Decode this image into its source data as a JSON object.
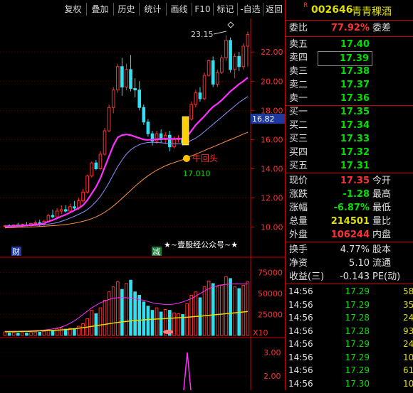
{
  "toolbar": {
    "buttons": [
      "复权",
      "叠加",
      "历史",
      "统计",
      "画线",
      "F10",
      "标记",
      "-自选",
      "返回"
    ]
  },
  "stock": {
    "badge": "R",
    "code": "002646",
    "name": "青青稞酒"
  },
  "order_book": {
    "weibi_label": "委比",
    "weibi_value": "77.92%",
    "weicha_label": "委差",
    "sells": [
      {
        "label": "卖五",
        "price": "17.40"
      },
      {
        "label": "卖四",
        "price": "17.39"
      },
      {
        "label": "卖三",
        "price": "17.38"
      },
      {
        "label": "卖二",
        "price": "17.37"
      },
      {
        "label": "卖一",
        "price": "17.36"
      }
    ],
    "buys": [
      {
        "label": "买一",
        "price": "17.35"
      },
      {
        "label": "买二",
        "price": "17.34"
      },
      {
        "label": "买三",
        "price": "17.33"
      },
      {
        "label": "买四",
        "price": "17.32"
      },
      {
        "label": "买五",
        "price": "17.31"
      }
    ]
  },
  "quote": [
    {
      "label": "现价",
      "value": "17.35",
      "label2": "今开",
      "color": "#ff3030"
    },
    {
      "label": "涨跌",
      "value": "-1.28",
      "label2": "最高",
      "color": "#00e000"
    },
    {
      "label": "涨幅",
      "value": "-6.87%",
      "label2": "最低",
      "color": "#00e000"
    },
    {
      "label": "总量",
      "value": "214501",
      "label2": "量比",
      "color": "#e0e000"
    },
    {
      "label": "外盘",
      "value": "106244",
      "label2": "内盘",
      "color": "#ff3030"
    }
  ],
  "quote2": [
    {
      "label": "换手",
      "value": "4.77%",
      "label2": "股本",
      "color": "#e0e0e0"
    },
    {
      "label": "净资",
      "value": "5.10",
      "label2": "流通",
      "color": "#e0e0e0"
    },
    {
      "label": "收益(三)",
      "value": "-0.143",
      "label2": "PE(动)",
      "color": "#e0e0e0"
    }
  ],
  "ticks": [
    {
      "time": "14:56",
      "price": "17.29",
      "vol": "58"
    },
    {
      "time": "14:56",
      "price": "17.29",
      "vol": "35"
    },
    {
      "time": "14:56",
      "price": "17.28",
      "vol": "24"
    },
    {
      "time": "14:56",
      "price": "17.28",
      "vol": "93"
    },
    {
      "time": "14:56",
      "price": "17.29",
      "vol": "24"
    },
    {
      "time": "14:56",
      "price": "17.29",
      "vol": "10"
    },
    {
      "time": "14:56",
      "price": "17.29",
      "vol": "61"
    },
    {
      "time": "14:56",
      "price": "17.30",
      "vol": "109"
    }
  ],
  "chart": {
    "annotation_high": "23.15",
    "current_price_tag": "16.82",
    "signal_label": "牛回头",
    "signal_price": "17.010",
    "watermark": "★~壹股经公众号~★",
    "marker_cai": "财",
    "marker_jian": "减",
    "vol_multiplier": "X10",
    "price_axis": [
      "22.00",
      "20.00",
      "18.00",
      "16.00",
      "14.00",
      "12.00",
      "10.00"
    ],
    "vol_axis": [
      "75000",
      "50000",
      "25000"
    ],
    "ind_axis": [
      "3.00",
      "2.00"
    ],
    "colors": {
      "up": "#ff3030",
      "down": "#30e0f0",
      "ma5": "#ff30ff",
      "ma10": "#9090ff",
      "ma20": "#ff9040",
      "volma": "#e0e000"
    }
  },
  "chart_data": {
    "type": "candlestick",
    "candles": [
      {
        "o": 10.05,
        "h": 10.15,
        "l": 9.95,
        "c": 10.1
      },
      {
        "o": 10.1,
        "h": 10.2,
        "l": 10.0,
        "c": 10.08
      },
      {
        "o": 10.05,
        "h": 10.2,
        "l": 10.0,
        "c": 10.15
      },
      {
        "o": 10.15,
        "h": 10.3,
        "l": 10.05,
        "c": 10.1
      },
      {
        "o": 10.1,
        "h": 10.25,
        "l": 10.0,
        "c": 10.2
      },
      {
        "o": 10.15,
        "h": 10.35,
        "l": 10.05,
        "c": 10.1
      },
      {
        "o": 10.1,
        "h": 10.3,
        "l": 10.0,
        "c": 10.25
      },
      {
        "o": 10.25,
        "h": 10.45,
        "l": 10.15,
        "c": 10.3
      },
      {
        "o": 10.3,
        "h": 10.5,
        "l": 10.05,
        "c": 10.15
      },
      {
        "o": 10.2,
        "h": 10.5,
        "l": 10.1,
        "c": 10.4
      },
      {
        "o": 10.4,
        "h": 10.9,
        "l": 10.3,
        "c": 10.8
      },
      {
        "o": 10.8,
        "h": 11.2,
        "l": 10.6,
        "c": 10.7
      },
      {
        "o": 10.7,
        "h": 11.3,
        "l": 10.6,
        "c": 11.1
      },
      {
        "o": 11.1,
        "h": 11.5,
        "l": 10.9,
        "c": 11.2
      },
      {
        "o": 11.2,
        "h": 11.5,
        "l": 11.0,
        "c": 11.1
      },
      {
        "o": 11.1,
        "h": 11.6,
        "l": 11.0,
        "c": 11.4
      },
      {
        "o": 11.4,
        "h": 11.8,
        "l": 11.2,
        "c": 11.3
      },
      {
        "o": 11.3,
        "h": 12.0,
        "l": 11.2,
        "c": 11.8
      },
      {
        "o": 11.8,
        "h": 12.6,
        "l": 11.7,
        "c": 12.4
      },
      {
        "o": 12.4,
        "h": 13.6,
        "l": 12.3,
        "c": 13.5
      },
      {
        "o": 13.5,
        "h": 14.5,
        "l": 13.4,
        "c": 14.4
      },
      {
        "o": 14.4,
        "h": 14.6,
        "l": 13.9,
        "c": 14.0
      },
      {
        "o": 14.0,
        "h": 15.2,
        "l": 13.9,
        "c": 15.0
      },
      {
        "o": 15.0,
        "h": 16.8,
        "l": 14.9,
        "c": 16.6
      },
      {
        "o": 16.6,
        "h": 18.4,
        "l": 16.5,
        "c": 18.2
      },
      {
        "o": 18.2,
        "h": 19.6,
        "l": 17.8,
        "c": 19.4
      },
      {
        "o": 19.4,
        "h": 21.2,
        "l": 19.2,
        "c": 21.0
      },
      {
        "o": 21.0,
        "h": 21.6,
        "l": 19.0,
        "c": 19.6
      },
      {
        "o": 19.6,
        "h": 21.2,
        "l": 19.4,
        "c": 20.8
      },
      {
        "o": 20.8,
        "h": 21.8,
        "l": 19.3,
        "c": 19.5
      },
      {
        "o": 19.5,
        "h": 20.2,
        "l": 18.9,
        "c": 19.4
      },
      {
        "o": 19.4,
        "h": 20.0,
        "l": 18.0,
        "c": 18.2
      },
      {
        "o": 18.2,
        "h": 18.4,
        "l": 17.0,
        "c": 17.2
      },
      {
        "o": 17.2,
        "h": 17.4,
        "l": 16.2,
        "c": 16.4
      },
      {
        "o": 16.4,
        "h": 16.6,
        "l": 15.6,
        "c": 15.9
      },
      {
        "o": 15.9,
        "h": 16.6,
        "l": 15.7,
        "c": 16.4
      },
      {
        "o": 16.4,
        "h": 16.7,
        "l": 15.8,
        "c": 16.0
      },
      {
        "o": 16.0,
        "h": 16.5,
        "l": 15.7,
        "c": 16.3
      },
      {
        "o": 16.3,
        "h": 16.6,
        "l": 15.2,
        "c": 15.5
      },
      {
        "o": 15.5,
        "h": 16.2,
        "l": 15.4,
        "c": 16.0
      },
      {
        "o": 16.0,
        "h": 16.3,
        "l": 15.8,
        "c": 16.1
      },
      {
        "o": 16.1,
        "h": 16.4,
        "l": 15.6,
        "c": 15.8
      },
      {
        "o": 15.8,
        "h": 17.5,
        "l": 15.7,
        "c": 17.4
      },
      {
        "o": 17.4,
        "h": 18.6,
        "l": 17.3,
        "c": 18.4
      },
      {
        "o": 18.4,
        "h": 19.4,
        "l": 18.2,
        "c": 19.2
      },
      {
        "o": 19.2,
        "h": 19.6,
        "l": 18.6,
        "c": 18.8
      },
      {
        "o": 18.8,
        "h": 20.6,
        "l": 18.7,
        "c": 20.4
      },
      {
        "o": 20.4,
        "h": 21.5,
        "l": 20.3,
        "c": 21.4
      },
      {
        "o": 21.4,
        "h": 21.7,
        "l": 19.6,
        "c": 19.8
      },
      {
        "o": 19.8,
        "h": 20.8,
        "l": 19.6,
        "c": 20.6
      },
      {
        "o": 20.6,
        "h": 21.8,
        "l": 20.5,
        "c": 21.6
      },
      {
        "o": 21.6,
        "h": 23.15,
        "l": 21.4,
        "c": 22.8
      },
      {
        "o": 22.8,
        "h": 23.0,
        "l": 20.6,
        "c": 20.8
      },
      {
        "o": 20.8,
        "h": 21.9,
        "l": 20.2,
        "c": 21.7
      },
      {
        "o": 21.7,
        "h": 22.0,
        "l": 20.7,
        "c": 21.0
      },
      {
        "o": 21.0,
        "h": 22.6,
        "l": 20.8,
        "c": 22.4
      },
      {
        "o": 22.4,
        "h": 23.4,
        "l": 21.0,
        "c": 23.2
      }
    ],
    "ma5": [
      10.05,
      10.06,
      10.08,
      10.09,
      10.11,
      10.12,
      10.15,
      10.18,
      10.2,
      10.25,
      10.38,
      10.48,
      10.6,
      10.74,
      10.85,
      11.0,
      11.15,
      11.3,
      11.5,
      11.85,
      12.3,
      12.75,
      13.35,
      14.1,
      14.85,
      15.6,
      16.15,
      16.3,
      16.35,
      16.3,
      16.2,
      16.1,
      16.0,
      15.98,
      16.0,
      16.02,
      16.05,
      16.05,
      16.05,
      16.05,
      16.05,
      16.05,
      16.2,
      16.6,
      17.0,
      17.3,
      17.6,
      17.95,
      18.25,
      18.45,
      18.7,
      19.0,
      19.3,
      19.55,
      19.8,
      20.0,
      20.25
    ],
    "ma10": [
      10.0,
      10.02,
      10.03,
      10.05,
      10.06,
      10.08,
      10.1,
      10.12,
      10.14,
      10.17,
      10.2,
      10.25,
      10.3,
      10.4,
      10.5,
      10.62,
      10.74,
      10.88,
      11.02,
      11.2,
      11.45,
      11.75,
      12.1,
      12.55,
      13.05,
      13.6,
      14.15,
      14.6,
      15.0,
      15.3,
      15.5,
      15.65,
      15.75,
      15.8,
      15.82,
      15.8,
      15.78,
      15.75,
      15.72,
      15.7,
      15.7,
      15.72,
      15.8,
      15.95,
      16.1,
      16.3,
      16.55,
      16.8,
      17.05,
      17.3,
      17.55,
      17.8,
      18.05,
      18.3,
      18.55,
      18.75,
      18.95
    ],
    "ma20": [
      9.95,
      9.96,
      9.97,
      9.98,
      9.99,
      10.0,
      10.01,
      10.02,
      10.04,
      10.06,
      10.08,
      10.1,
      10.12,
      10.15,
      10.18,
      10.22,
      10.27,
      10.33,
      10.4,
      10.48,
      10.58,
      10.7,
      10.85,
      11.02,
      11.22,
      11.45,
      11.7,
      11.97,
      12.25,
      12.52,
      12.8,
      13.05,
      13.3,
      13.52,
      13.72,
      13.9,
      14.05,
      14.2,
      14.32,
      14.42,
      14.52,
      14.62,
      14.75,
      14.88,
      15.0,
      15.12,
      15.25,
      15.38,
      15.5,
      15.62,
      15.75,
      15.88,
      16.0,
      16.12,
      16.25,
      16.38,
      16.5
    ],
    "volume": [
      4200,
      3000,
      3500,
      2800,
      3200,
      2900,
      3600,
      4000,
      3800,
      5000,
      7000,
      6200,
      8000,
      9000,
      7500,
      8500,
      7800,
      11000,
      14000,
      20000,
      30000,
      26000,
      33000,
      42000,
      52000,
      58000,
      64000,
      55000,
      62000,
      66000,
      52000,
      48000,
      40000,
      35000,
      30000,
      33000,
      28000,
      31000,
      30000,
      27000,
      26000,
      25000,
      38000,
      48000,
      52000,
      45000,
      58000,
      65000,
      62000,
      58000,
      60000,
      70000,
      68000,
      58000,
      56000,
      60000,
      64000
    ],
    "vol_ma": [
      5000,
      5000,
      5000,
      5000,
      5200,
      5200,
      5500,
      5800,
      6000,
      6500,
      7000,
      7800,
      8800,
      10000,
      12000,
      14500,
      17500,
      21000,
      25000,
      29000,
      33000,
      36000,
      39000,
      41000,
      43000,
      44500,
      45000,
      45200,
      45000,
      44500,
      44000,
      43000,
      42000,
      40500,
      39000,
      38000,
      37500,
      37000,
      37000,
      37500,
      38500,
      40000,
      42000,
      44000,
      47000,
      50000,
      53000,
      56000,
      58000,
      59500,
      60500,
      61000,
      61500,
      61500,
      61500,
      61500,
      61500
    ],
    "vol_ma2": [
      4500,
      4500,
      4600,
      4700,
      4800,
      4900,
      5000,
      5200,
      5400,
      5600,
      5800,
      6000,
      6300,
      6600,
      7000,
      7500,
      8000,
      8600,
      9300,
      10000,
      10800,
      11600,
      12400,
      13200,
      14000,
      14800,
      15500,
      16200,
      16800,
      17300,
      17800,
      18200,
      18600,
      19000,
      19300,
      19600,
      19900,
      20200,
      20500,
      20800,
      21100,
      21400,
      21800,
      22200,
      22600,
      23000,
      23500,
      24000,
      24500,
      25000,
      25500,
      26000,
      26500,
      27000,
      27500,
      28000,
      28500
    ]
  }
}
